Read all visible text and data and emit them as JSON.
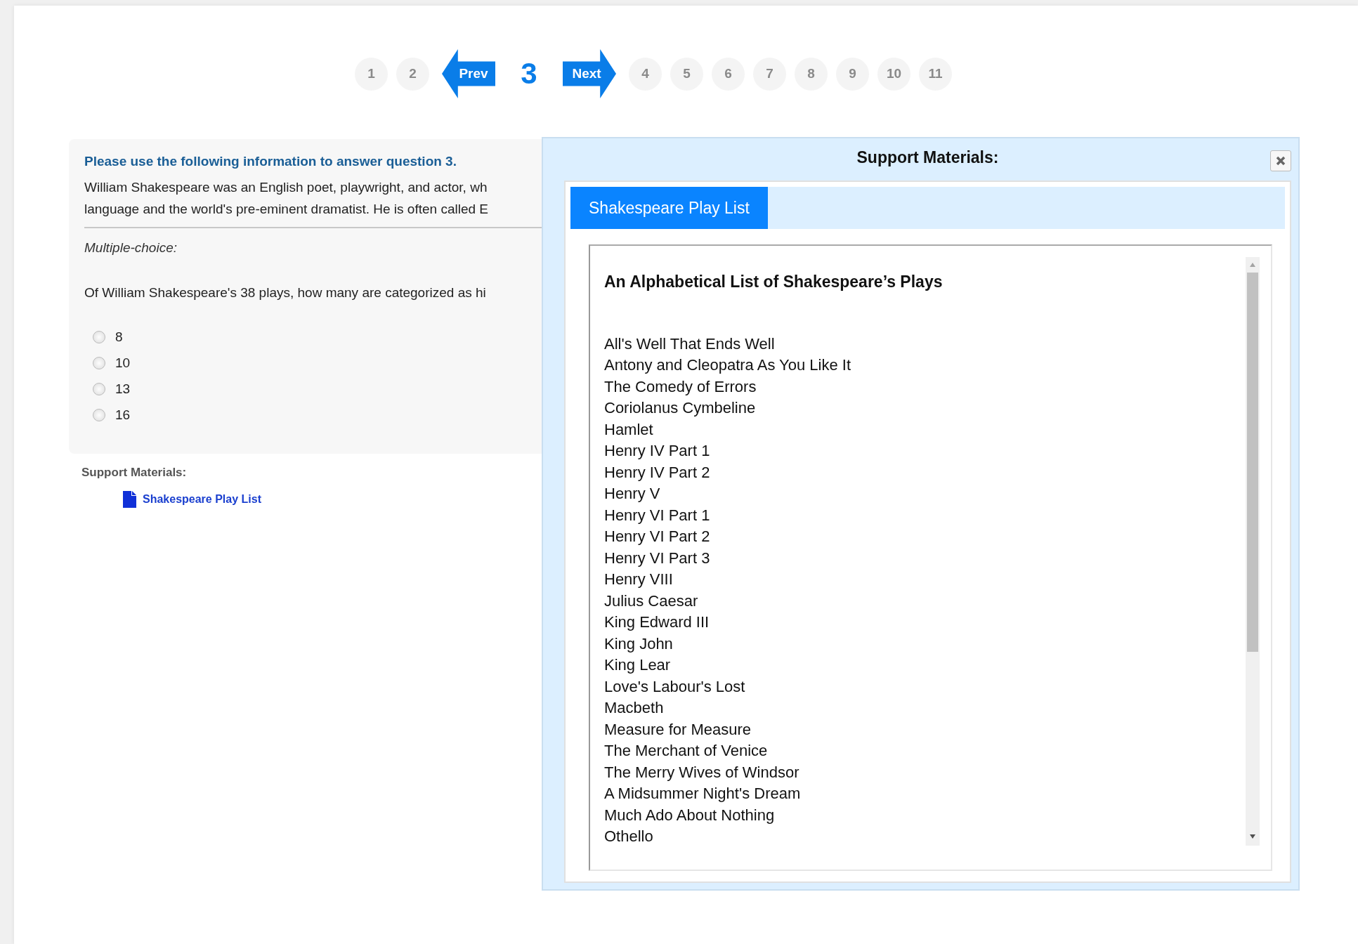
{
  "pagination": {
    "prev": "Prev",
    "next": "Next",
    "pages": [
      {
        "label": "1",
        "selected": false
      },
      {
        "label": "2",
        "selected": false
      },
      {
        "label": "3",
        "selected": true
      },
      {
        "label": "4",
        "selected": false
      },
      {
        "label": "5",
        "selected": false
      },
      {
        "label": "6",
        "selected": false
      },
      {
        "label": "7",
        "selected": false
      },
      {
        "label": "8",
        "selected": false
      },
      {
        "label": "9",
        "selected": false
      },
      {
        "label": "10",
        "selected": false
      },
      {
        "label": "11",
        "selected": false
      }
    ]
  },
  "question": {
    "heading": "Please use the following information to answer question 3.",
    "passage_lines": [
      "William Shakespeare was an English poet, playwright, and actor, wh",
      "language and the world's pre-eminent dramatist. He is often called E"
    ],
    "type_label": "Multiple-choice:",
    "prompt": "Of William Shakespeare's 38 plays, how many are categorized as hi",
    "options": [
      {
        "label": "8",
        "selected": false
      },
      {
        "label": "10",
        "selected": false
      },
      {
        "label": "13",
        "selected": false
      },
      {
        "label": "16",
        "selected": false
      }
    ]
  },
  "support_materials": {
    "label": "Support Materials:",
    "links": [
      "Shakespeare Play List"
    ]
  },
  "dialog": {
    "title": "Support Materials:",
    "tabs": [
      {
        "label": "Shakespeare Play List",
        "selected": true
      }
    ],
    "document": {
      "title": "An Alphabetical List of Shakespeare’s Plays",
      "items": [
        "All's Well That Ends Well",
        "Antony and Cleopatra As You Like It",
        "The Comedy of Errors",
        "Coriolanus Cymbeline",
        "Hamlet",
        "Henry IV Part 1",
        "Henry IV Part 2",
        "Henry V",
        "Henry VI Part 1",
        "Henry VI Part 2",
        "Henry VI Part 3",
        "Henry VIII",
        "Julius Caesar",
        "King Edward III",
        "King John",
        "King Lear",
        "Love's Labour's Lost",
        "Macbeth",
        "Measure for Measure",
        "The Merchant of Venice",
        "The Merry Wives of Windsor",
        "A Midsummer Night's Dream",
        "Much Ado About Nothing",
        "Othello"
      ]
    }
  }
}
